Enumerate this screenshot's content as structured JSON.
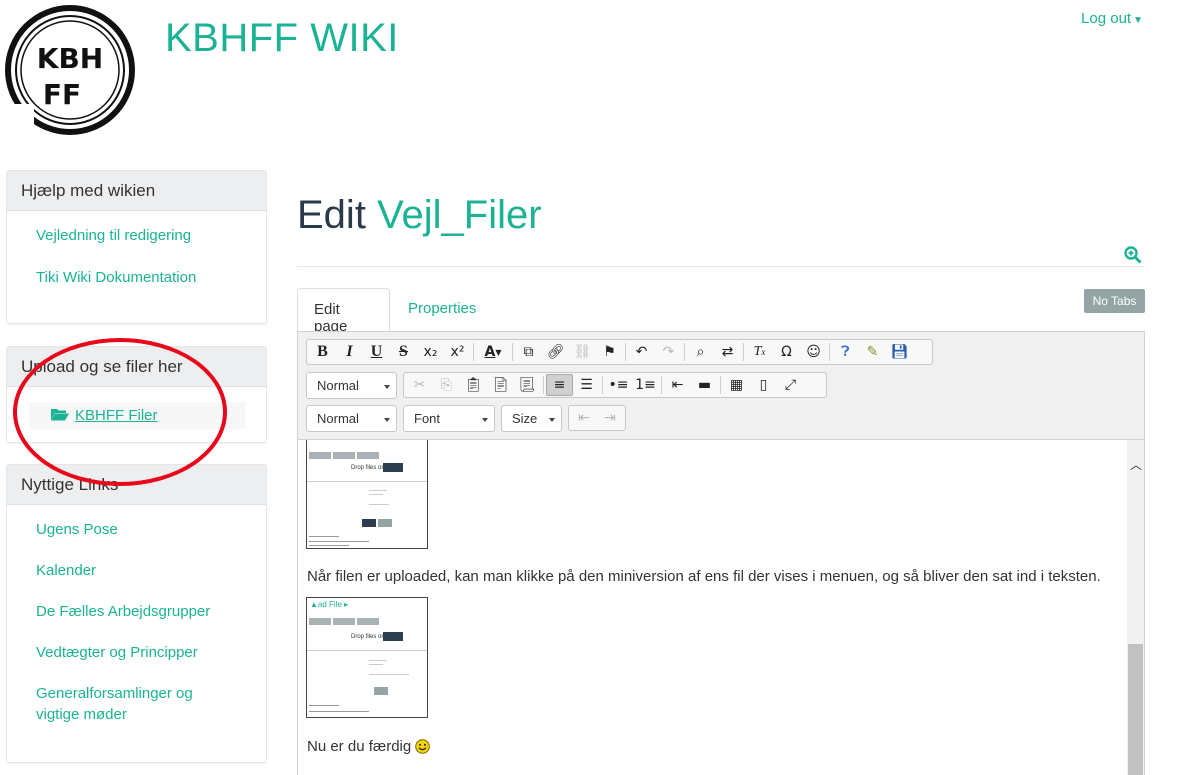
{
  "header": {
    "logo_text_line1": "KBH",
    "logo_text_line2": "FF",
    "site_title": "KBHFF WIKI",
    "logout_label": "Log out"
  },
  "sidebar": {
    "help_panel": {
      "title": "Hjælp med wikien",
      "links": [
        "Vejledning til redigering",
        "Tiki Wiki Dokumentation"
      ]
    },
    "upload_panel": {
      "title": "Upload og se filer her",
      "item_label": "KBHFF Filer"
    },
    "links_panel": {
      "title": "Nyttige Links",
      "links": [
        "Ugens Pose",
        "Kalender",
        "De Fælles Arbejdsgrupper",
        "Vedtægter og Principper",
        "Generalforsamlinger og",
        "vigtige møder"
      ]
    }
  },
  "main": {
    "title_prefix": "Edit",
    "page_name": "Vejl_Filer",
    "tabs": [
      {
        "label": "Edit page",
        "active": true
      },
      {
        "label": "Properties",
        "active": false
      }
    ],
    "no_tabs_label": "No Tabs"
  },
  "editor": {
    "format_select": "Normal",
    "style_select": "Normal",
    "font_select": "Font",
    "size_select": "Size",
    "paragraph_1": "Når filen er uploaded, kan man klikke på den miniversion af ens fil der vises i menuen, og så bliver den sat ind i teksten.",
    "paragraph_2": "Nu er du færdig",
    "thumb_drop_text": "Drop files or"
  },
  "colors": {
    "accent": "#1bb394",
    "dark_title": "#2b3a4a",
    "annotation_red": "#e8081b",
    "badge_gray": "#95a5a6"
  }
}
